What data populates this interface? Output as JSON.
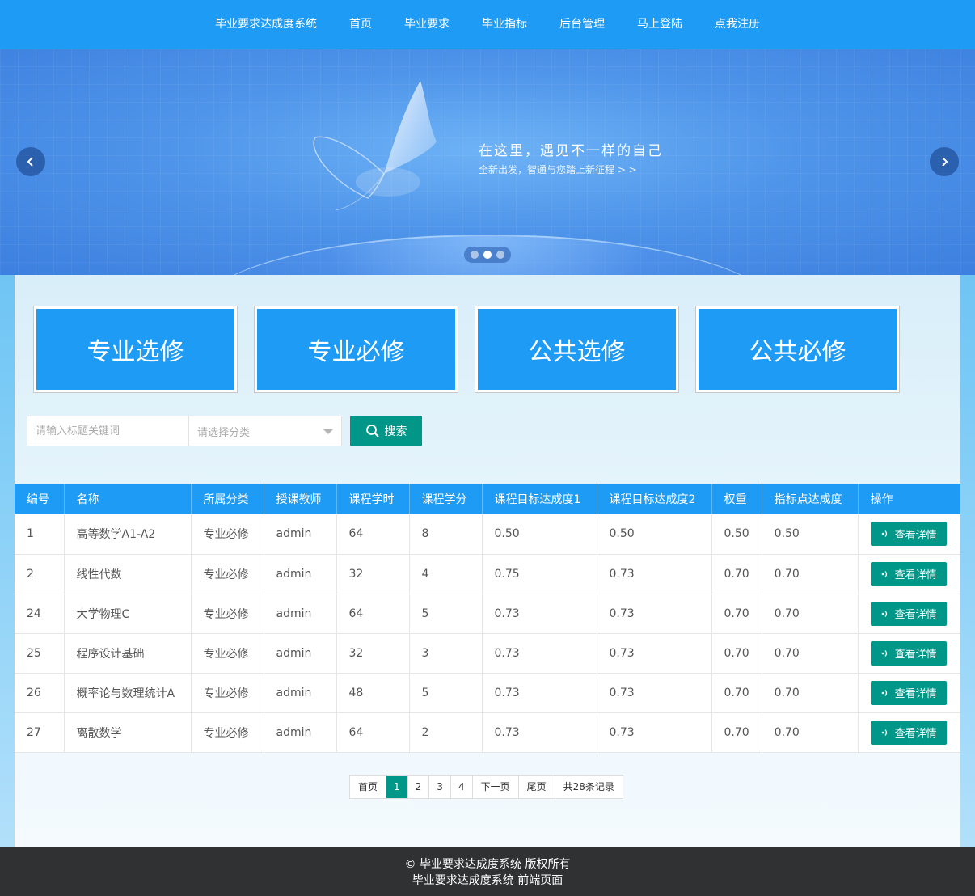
{
  "nav": {
    "items": [
      {
        "label": "毕业要求达成度系统"
      },
      {
        "label": "首页"
      },
      {
        "label": "毕业要求"
      },
      {
        "label": "毕业指标"
      },
      {
        "label": "后台管理"
      },
      {
        "label": "马上登陆"
      },
      {
        "label": "点我注册"
      }
    ]
  },
  "banner": {
    "slogan": "在这里，遇见不一样的自己",
    "sub_slogan": "全新出发，智通与您踏上新征程 > >",
    "prev_icon": "chevron-left-icon",
    "next_icon": "chevron-right-icon",
    "active_slide": 2,
    "slide_count": 3
  },
  "categories": [
    {
      "label": "专业选修"
    },
    {
      "label": "专业必修"
    },
    {
      "label": "公共选修"
    },
    {
      "label": "公共必修"
    }
  ],
  "search": {
    "placeholder": "请输入标题关键词",
    "category_placeholder": "请选择分类",
    "button_label": "搜索",
    "button_icon": "search-icon"
  },
  "table": {
    "headers": [
      "编号",
      "名称",
      "所属分类",
      "授课教师",
      "课程学时",
      "课程学分",
      "课程目标达成度1",
      "课程目标达成度2",
      "权重",
      "指标点达成度",
      "操作"
    ],
    "rows": [
      {
        "id": "1",
        "name": "高等数学A1-A2",
        "category": "专业必修",
        "teacher": "admin",
        "hours": "64",
        "credits": "8",
        "goal1": "0.50",
        "goal2": "0.50",
        "weight": "0.50",
        "index": "0.50"
      },
      {
        "id": "2",
        "name": "线性代数",
        "category": "专业必修",
        "teacher": "admin",
        "hours": "32",
        "credits": "4",
        "goal1": "0.75",
        "goal2": "0.73",
        "weight": "0.70",
        "index": "0.70"
      },
      {
        "id": "24",
        "name": "大学物理C",
        "category": "专业必修",
        "teacher": "admin",
        "hours": "64",
        "credits": "5",
        "goal1": "0.73",
        "goal2": "0.73",
        "weight": "0.70",
        "index": "0.70"
      },
      {
        "id": "25",
        "name": "程序设计基础",
        "category": "专业必修",
        "teacher": "admin",
        "hours": "32",
        "credits": "3",
        "goal1": "0.73",
        "goal2": "0.73",
        "weight": "0.70",
        "index": "0.70"
      },
      {
        "id": "26",
        "name": "概率论与数理统计A",
        "category": "专业必修",
        "teacher": "admin",
        "hours": "48",
        "credits": "5",
        "goal1": "0.73",
        "goal2": "0.73",
        "weight": "0.70",
        "index": "0.70"
      },
      {
        "id": "27",
        "name": "离散数学",
        "category": "专业必修",
        "teacher": "admin",
        "hours": "64",
        "credits": "2",
        "goal1": "0.73",
        "goal2": "0.73",
        "weight": "0.70",
        "index": "0.70"
      }
    ],
    "action_label": "查看详情",
    "action_icon": "broadcast-icon"
  },
  "pagination": {
    "first": "首页",
    "pages": [
      "1",
      "2",
      "3",
      "4"
    ],
    "current": "1",
    "next": "下一页",
    "last": "尾页",
    "total": "共28条记录"
  },
  "footer": {
    "line1": "© 毕业要求达成度系统 版权所有",
    "line2": "毕业要求达成度系统 前端页面"
  },
  "colors": {
    "primary_blue": "#1e9bf5",
    "accent_green": "#009688",
    "footer_bg": "#2f3133"
  }
}
